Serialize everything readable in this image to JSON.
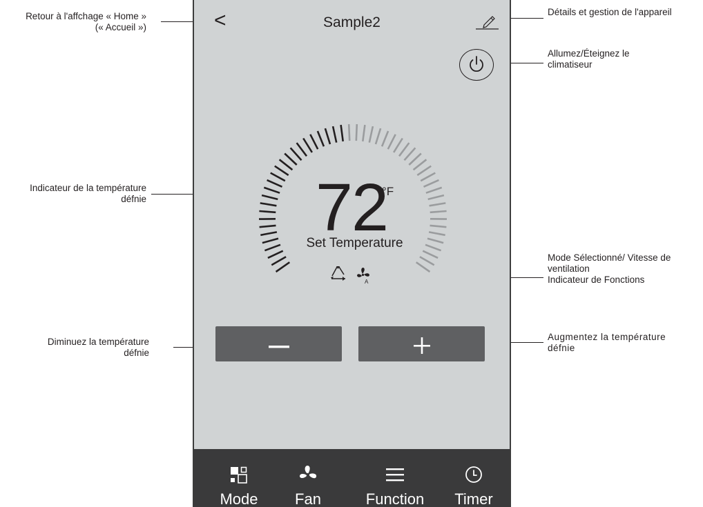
{
  "annotations": {
    "back": [
      "Retour à l'affchage « Home »",
      "(« Accueil »)"
    ],
    "details": "Détails et gestion de l'appareil",
    "power": [
      "Allumez/Éteignez le",
      "climatiseur"
    ],
    "temp_indicator": [
      "Indicateur de la température",
      "défnie"
    ],
    "mode_indicator": [
      "Mode Sélectionné/ Vitesse de",
      "ventilation",
      "Indicateur de Fonctions"
    ],
    "decrease": [
      "Diminuez la température",
      "défnie"
    ],
    "increase": [
      "Augmentez la température",
      "défnie"
    ]
  },
  "device": {
    "title": "Sample2",
    "back_glyph": "<",
    "edit_icon": "pencil-icon",
    "power_icon": "power-icon"
  },
  "thermostat": {
    "value": "72",
    "unit": "°F",
    "label": "Set Temperature",
    "mode_icon": "recycle-triangle-icon",
    "fan_icon": "fan-auto-icon"
  },
  "controls": {
    "minus_icon": "minus-icon",
    "plus_icon": "plus-icon"
  },
  "tabs": [
    {
      "label": "Mode",
      "icon": "mode-icon"
    },
    {
      "label": "Fan",
      "icon": "fan-icon"
    },
    {
      "label": "Function",
      "icon": "menu-icon"
    },
    {
      "label": "Timer",
      "icon": "clock-icon"
    }
  ],
  "colors": {
    "screen_bg": "#d0d3d4",
    "button_bg": "#5f6062",
    "bar_bg": "#3a3a3b",
    "tick_active": "#231f20",
    "tick_inactive": "#9a9c9e"
  }
}
